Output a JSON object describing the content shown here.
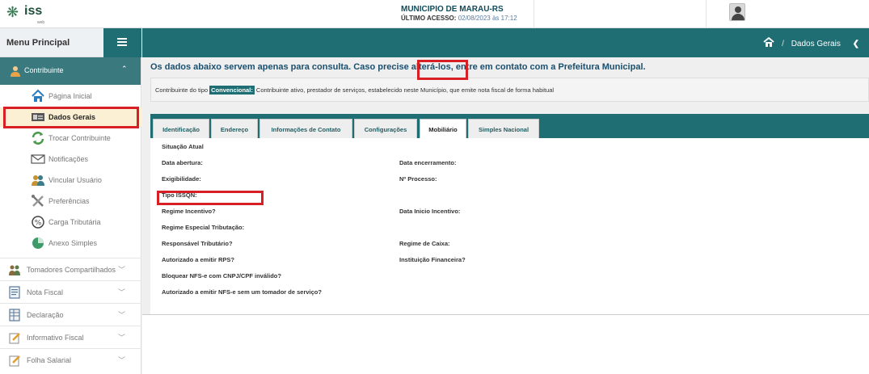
{
  "header": {
    "logo_text": "iss",
    "logo_sub": "web",
    "municipio": "MUNICIPIO DE MARAU-RS",
    "ultimo_acesso_label": "ÚLTIMO ACESSO:",
    "ultimo_acesso_value": "02/08/2023 às 17:12"
  },
  "sidebar": {
    "menu_title": "Menu Principal",
    "section": {
      "label": "Contribuinte"
    },
    "sub_items": [
      {
        "label": "Página Inicial",
        "icon": "home-icon"
      },
      {
        "label": "Dados Gerais",
        "icon": "id-card-icon"
      },
      {
        "label": "Trocar Contribuinte",
        "icon": "refresh-icon"
      },
      {
        "label": "Notificações",
        "icon": "envelope-icon"
      },
      {
        "label": "Vincular Usuário",
        "icon": "users-icon"
      },
      {
        "label": "Preferências",
        "icon": "tools-icon"
      },
      {
        "label": "Carga Tributária",
        "icon": "percent-icon"
      },
      {
        "label": "Anexo Simples",
        "icon": "pie-icon"
      }
    ],
    "groups": [
      {
        "label": "Tomadores Compartilhados"
      },
      {
        "label": "Nota Fiscal"
      },
      {
        "label": "Declaração"
      },
      {
        "label": "Informativo Fiscal"
      },
      {
        "label": "Folha Salarial"
      }
    ]
  },
  "breadcrumb": {
    "page": "Dados Gerais",
    "separator": "/"
  },
  "notice": "Os dados abaixo servem apenas para consulta. Caso precise alterá-los, entre em contato com a Prefeitura Municipal.",
  "contribuinte_tipo": {
    "prefix": "Contribuinte do tipo ",
    "badge": "Convencional:",
    "description": " Contribuinte ativo, prestador de serviços, estabelecido neste Município, que emite nota fiscal de forma habitual"
  },
  "tabs": [
    {
      "label": "Identificação"
    },
    {
      "label": "Endereço"
    },
    {
      "label": "Informações de Contato"
    },
    {
      "label": "Configurações"
    },
    {
      "label": "Mobiliário",
      "active": true
    },
    {
      "label": "Simples Nacional"
    }
  ],
  "fields": {
    "situacao_atual": "Situação Atual",
    "data_abertura": "Data abertura:",
    "data_encerramento": "Data encerramento:",
    "exigibilidade": "Exigibilidade:",
    "numero_processo": "Nº Processo:",
    "tipo_issqn": "Tipo ISSQN:",
    "regime_incentivo": "Regime Incentivo?",
    "data_inicio_incentivo": "Data Inicio Incentivo:",
    "regime_especial": "Regime Especial Tributação:",
    "responsavel_tributario": "Responsável Tributário?",
    "regime_caixa": "Regime de Caixa:",
    "autorizado_rps": "Autorizado a emitir RPS?",
    "instituicao_financeira": "Instituição Financeira?",
    "bloquear_nfse": "Bloquear NFS-e com CNPJ/CPF inválido?",
    "autorizado_nfse_sem_tomador": "Autorizado a emitir NFS-e sem um tomador de serviço?"
  },
  "colors": {
    "teal": "#1f6e73",
    "teal_light": "#3a7a7e",
    "highlight_red": "#d91f26",
    "active_item_bg": "#fbf0d4"
  }
}
